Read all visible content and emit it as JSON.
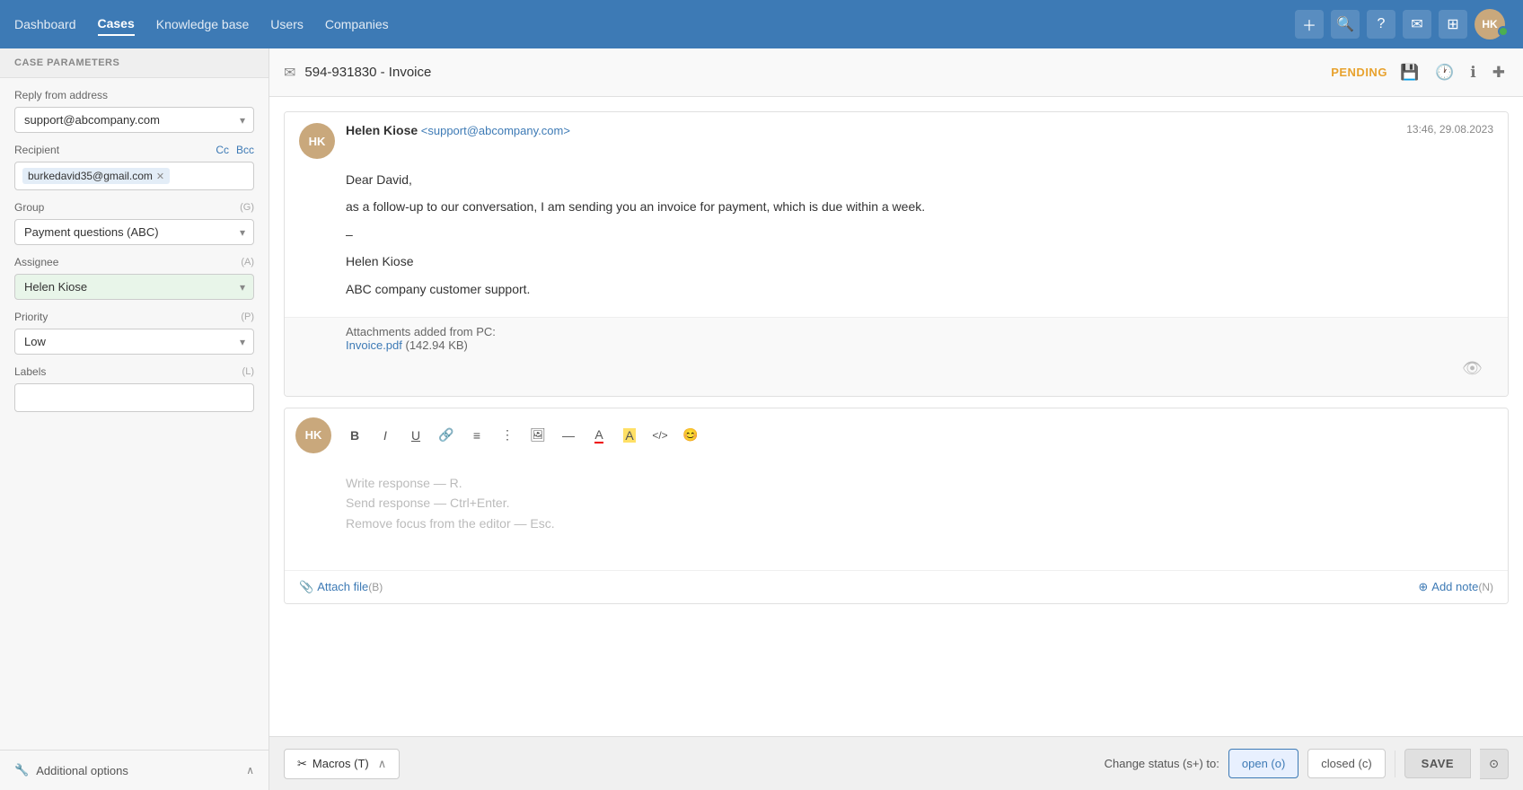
{
  "nav": {
    "items": [
      {
        "label": "Dashboard",
        "active": false
      },
      {
        "label": "Cases",
        "active": true
      },
      {
        "label": "Knowledge base",
        "active": false
      },
      {
        "label": "Users",
        "active": false
      },
      {
        "label": "Companies",
        "active": false
      }
    ],
    "actions": {
      "add": "+",
      "search": "🔍",
      "help": "?",
      "email": "✉",
      "grid": "⊞"
    },
    "avatar_initials": "HK",
    "status_color": "#4caf50"
  },
  "sidebar": {
    "header": "CASE PARAMETERS",
    "reply_from": {
      "label": "Reply from address",
      "value": "support@abcompany.com"
    },
    "recipient": {
      "label": "Recipient",
      "cc_label": "Cc",
      "bcc_label": "Bcc",
      "tags": [
        {
          "email": "burkedavid35@gmail.com"
        }
      ]
    },
    "group": {
      "label": "Group",
      "shortcut": "(G)",
      "value": "Payment questions (ABC)"
    },
    "assignee": {
      "label": "Assignee",
      "shortcut": "(A)",
      "value": "Helen Kiose"
    },
    "priority": {
      "label": "Priority",
      "shortcut": "(P)",
      "value": "Low"
    },
    "labels": {
      "label": "Labels",
      "shortcut": "(L)",
      "placeholder": ""
    },
    "additional_options": "Additional options",
    "additional_chevron": "∧"
  },
  "case_header": {
    "case_number": "594-931830 - Invoice",
    "status": "PENDING",
    "icons": {
      "save": "💾",
      "history": "🕐",
      "info": "ℹ",
      "plus": "✚"
    }
  },
  "message": {
    "sender_name": "Helen Kiose",
    "sender_email": "<support@abcompany.com>",
    "timestamp": "13:46, 29.08.2023",
    "avatar_initials": "HK",
    "greeting": "Dear David,",
    "body": "as a follow-up to our conversation, I am sending you an invoice for payment, which is due within a week.",
    "signature_dash": "–",
    "signature_name": "Helen Kiose",
    "signature_company": "ABC company customer support.",
    "attachments_label": "Attachments added from PC:",
    "attachment_name": "Invoice.pdf",
    "attachment_size": "(142.94 KB)"
  },
  "reply": {
    "avatar_initials": "HK",
    "toolbar": {
      "bold": "B",
      "italic": "I",
      "underline": "U",
      "link": "🔗",
      "ordered_list": "≡",
      "unordered_list": "≡",
      "image": "🖼",
      "hr": "—",
      "font_color": "A",
      "bg_color": "A",
      "code": "</>",
      "emoji": "😊"
    },
    "placeholder_line1": "Write response — R.",
    "placeholder_line2": "Send response — Ctrl+Enter.",
    "placeholder_line3": "Remove focus from the editor — Esc.",
    "attach_label": "Attach file",
    "attach_shortcut": "(B)",
    "add_note_label": "Add note",
    "add_note_shortcut": "(N)"
  },
  "bottom_bar": {
    "macros_label": "Macros (T)",
    "status_change_label": "Change status (s+) to:",
    "open_label": "open (o)",
    "closed_label": "closed (c)",
    "save_label": "SAVE"
  }
}
